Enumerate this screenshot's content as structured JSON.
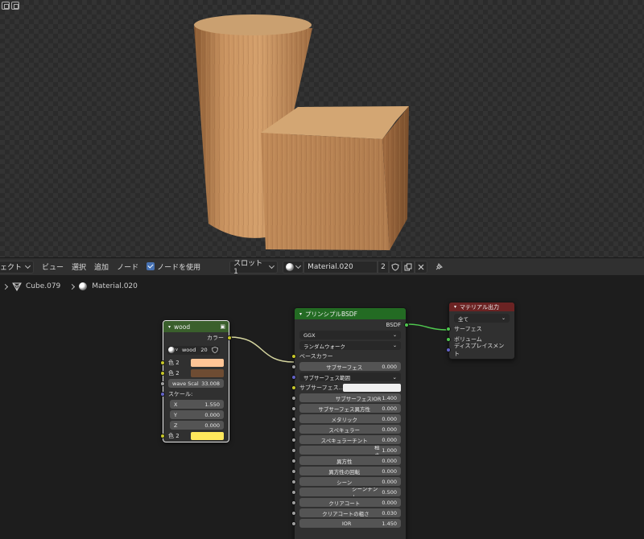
{
  "viewport": {
    "icons": [
      "render-region-icon",
      "overlay-icon"
    ]
  },
  "header": {
    "editor_menu": "ェクト",
    "menu_view": "ビュー",
    "menu_select": "選択",
    "menu_add": "追加",
    "menu_node": "ノード",
    "use_nodes_label": "ノードを使用",
    "use_nodes_checked": true,
    "slot": "スロット1",
    "material_name": "Material.020",
    "user_count": "2"
  },
  "breadcrumb": {
    "object": "Cube.079",
    "material": "Material.020"
  },
  "wood_node": {
    "title": "wood",
    "output_color": "カラー",
    "texture_name": "wood",
    "texture_users": "20",
    "color1_label": "色 2",
    "color1": "#ffc596",
    "color2_label": "色 2",
    "color2": "#6e4c33",
    "wave_label": "wave Scal",
    "wave_value": "33.008",
    "scale_label": "スケール:",
    "scale_x_label": "X",
    "scale_x": "1.550",
    "scale_y_label": "Y",
    "scale_y": "0.000",
    "scale_z_label": "Z",
    "scale_z": "0.000",
    "color3_label": "色 2",
    "color3": "#ffe85c"
  },
  "bsdf_node": {
    "title": "プリンシプルBSDF",
    "output": "BSDF",
    "distribution": "GGX",
    "subsurface_method": "ランダムウォーク",
    "base_color_label": "ベースカラー",
    "rows": [
      {
        "label": "サブサーフェス",
        "value": "0.000",
        "socket": "gray",
        "fill": 0
      },
      {
        "label": "サブサーフェス範囲",
        "value": "",
        "socket": "blue",
        "type": "dropdown"
      },
      {
        "label": "サブサーフェス...",
        "value": "",
        "socket": "yellow",
        "type": "color"
      },
      {
        "label": "サブサーフェスIOR",
        "value": "1.400",
        "socket": "gray",
        "fill": 0.3
      },
      {
        "label": "サブサーフェス異方性",
        "value": "0.000",
        "socket": "gray",
        "fill": 0
      },
      {
        "label": "メタリック",
        "value": "0.000",
        "socket": "gray",
        "fill": 0
      },
      {
        "label": "スペキュラー",
        "value": "0.000",
        "socket": "gray",
        "fill": 0
      },
      {
        "label": "スペキュラーチント",
        "value": "0.000",
        "socket": "gray",
        "fill": 0
      },
      {
        "label": "粗さ",
        "value": "1.000",
        "socket": "gray",
        "fill": 1.0
      },
      {
        "label": "異方性",
        "value": "0.000",
        "socket": "gray",
        "fill": 0
      },
      {
        "label": "異方性の回転",
        "value": "0.000",
        "socket": "gray",
        "fill": 0
      },
      {
        "label": "シーン",
        "value": "0.000",
        "socket": "gray",
        "fill": 0
      },
      {
        "label": "シーンチント",
        "value": "0.500",
        "socket": "gray",
        "fill": 0.5
      },
      {
        "label": "クリアコート",
        "value": "0.000",
        "socket": "gray",
        "fill": 0
      },
      {
        "label": "クリアコートの粗さ",
        "value": "0.030",
        "socket": "gray",
        "fill": 0.03
      },
      {
        "label": "IOR",
        "value": "1.450",
        "socket": "gray",
        "fill": 0.05
      }
    ],
    "subsurface_color": "#f0f0f0"
  },
  "output_node": {
    "title": "マテリアル出力",
    "target": "全て",
    "surface_label": "サーフェス",
    "volume_label": "ボリューム",
    "displacement_label": "ディスプレイスメント"
  },
  "colors": {
    "node_green_header": "#236b23",
    "output_red_header": "#6b2323",
    "texture_header": "#3a5f2c",
    "accent_blue": "#4772b3"
  }
}
